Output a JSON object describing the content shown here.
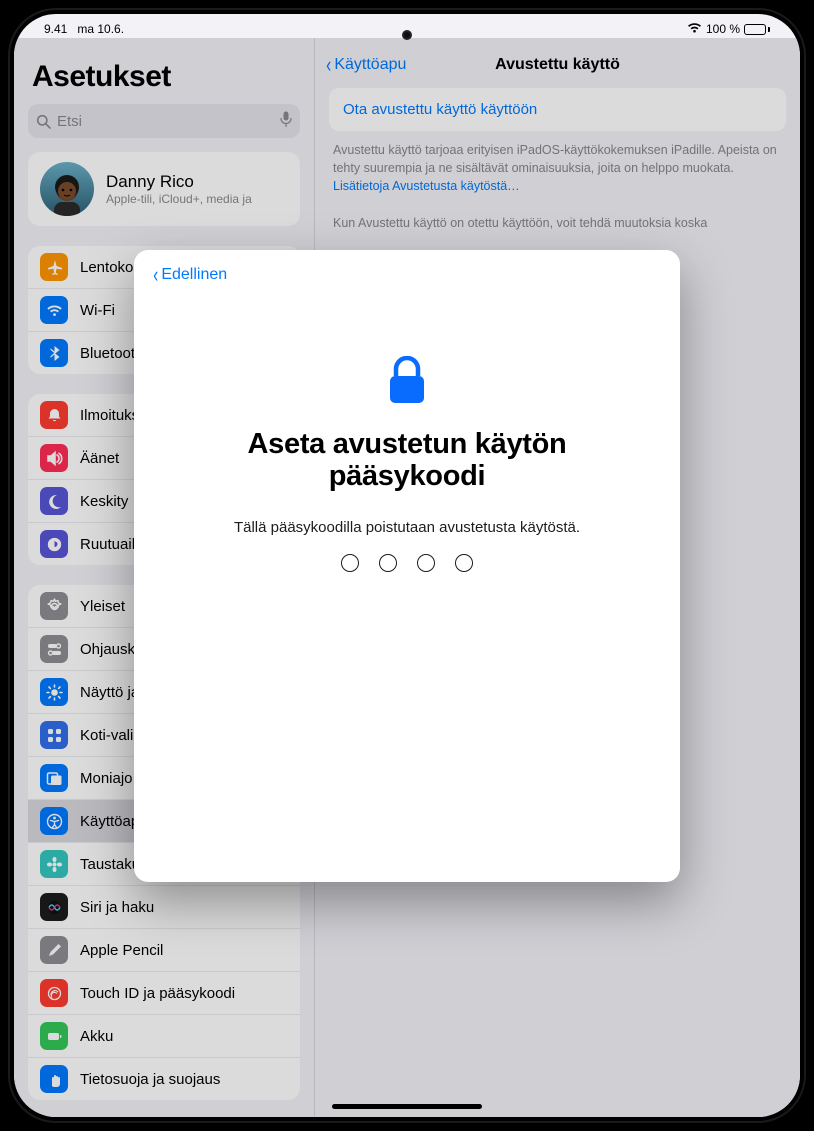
{
  "status": {
    "time": "9.41",
    "date": "ma 10.6.",
    "battery_pct": "100 %"
  },
  "sidebar": {
    "title": "Asetukset",
    "search_placeholder": "Etsi",
    "profile": {
      "name": "Danny Rico",
      "sub": "Apple-tili, iCloud+, media ja"
    },
    "group1": [
      {
        "icon": "airplane",
        "bg": "#ff9500",
        "label": "Lentokonetila"
      },
      {
        "icon": "wifi",
        "bg": "#007aff",
        "label": "Wi-Fi"
      },
      {
        "icon": "bluetooth",
        "bg": "#007aff",
        "label": "Bluetooth"
      }
    ],
    "group2": [
      {
        "icon": "bell",
        "bg": "#ff3b30",
        "label": "Ilmoitukset"
      },
      {
        "icon": "sound",
        "bg": "#ff2d55",
        "label": "Äänet"
      },
      {
        "icon": "moon",
        "bg": "#5856d6",
        "label": "Keskity"
      },
      {
        "icon": "timer",
        "bg": "#5856d6",
        "label": "Ruutuaika"
      }
    ],
    "group3": [
      {
        "icon": "gear",
        "bg": "#8e8e93",
        "label": "Yleiset"
      },
      {
        "icon": "switches",
        "bg": "#8e8e93",
        "label": "Ohjauskeskus"
      },
      {
        "icon": "brightness",
        "bg": "#007aff",
        "label": "Näyttö ja kirkkaus"
      },
      {
        "icon": "grid",
        "bg": "#2f6feb",
        "label": "Koti-valikko ja Apin kirjasto"
      },
      {
        "icon": "multitask",
        "bg": "#007aff",
        "label": "Moniajo ja eleet"
      },
      {
        "icon": "access",
        "bg": "#007aff",
        "label": "Käyttöapu",
        "selected": true
      },
      {
        "icon": "flower",
        "bg": "#34c7c0",
        "label": "Taustakuva"
      },
      {
        "icon": "siri",
        "bg": "#1c1c1e",
        "label": "Siri ja haku"
      },
      {
        "icon": "pencil",
        "bg": "#8e8e93",
        "label": "Apple Pencil"
      },
      {
        "icon": "touchid",
        "bg": "#ff3b30",
        "label": "Touch ID ja pääsykoodi"
      },
      {
        "icon": "battery",
        "bg": "#34c759",
        "label": "Akku"
      },
      {
        "icon": "hand",
        "bg": "#007aff",
        "label": "Tietosuoja ja suojaus"
      }
    ]
  },
  "content": {
    "back": "Käyttöapu",
    "title": "Avustettu käyttö",
    "action": "Ota avustettu käyttö käyttöön",
    "desc1": "Avustettu käyttö tarjoaa erityisen iPadOS-käyttökokemuksen iPadille. Apeista on tehty suurempia ja ne sisältävät ominaisuuksia, joita on helppo muokata. ",
    "link": "Lisätietoja Avustetusta käytöstä…",
    "desc2": "Kun Avustettu käyttö on otettu käyttöön, voit tehdä muutoksia koska"
  },
  "modal": {
    "back": "Edellinen",
    "title": "Aseta avustetun käytön pääsykoodi",
    "subtitle": "Tällä pääsykoodilla poistutaan avustetusta käytöstä."
  }
}
